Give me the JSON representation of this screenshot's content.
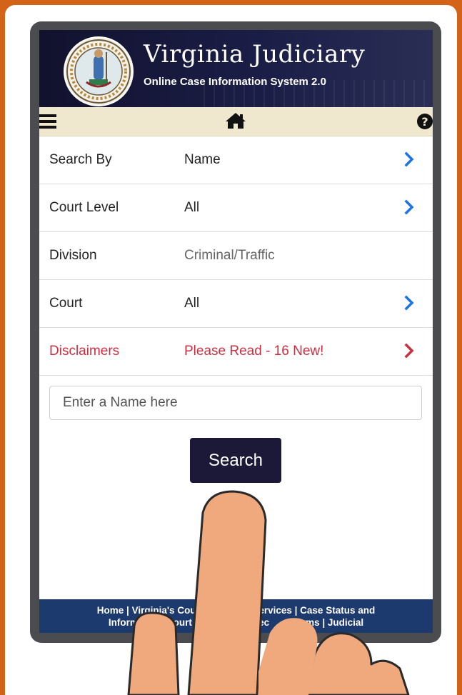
{
  "header": {
    "title": "Virginia Judiciary",
    "subtitle": "Online Case Information System 2.0",
    "seal_icon": "virginia-seal-icon"
  },
  "navbar": {
    "menu_icon": "hamburger-menu-icon",
    "home_icon": "home-icon",
    "help_icon": "question-circle-icon"
  },
  "rows": [
    {
      "label": "Search By",
      "value": "Name",
      "has_chevron": true
    },
    {
      "label": "Court Level",
      "value": "All",
      "has_chevron": true
    },
    {
      "label": "Division",
      "value": "Criminal/Traffic",
      "has_chevron": false
    },
    {
      "label": "Court",
      "value": "All",
      "has_chevron": true
    },
    {
      "label": "Disclaimers",
      "value": "Please Read - 16 New!",
      "has_chevron": true
    }
  ],
  "search": {
    "placeholder": "Enter a Name here",
    "value": "",
    "button_label": "Search"
  },
  "footer": {
    "line1": "Home | Virginia's Court Sy          e Services | Case Status and",
    "line2": "Informatio    Court Adm           Direc          orms | Judicial"
  },
  "colors": {
    "background": "#d4631a",
    "banner": "#1a1d46",
    "navbar": "#efe8cf",
    "link_blue": "#1a73e8",
    "alert_red": "#cc2f3f",
    "button": "#1b1838",
    "footer": "#1d3a6e",
    "hand": "#f0a97c"
  }
}
